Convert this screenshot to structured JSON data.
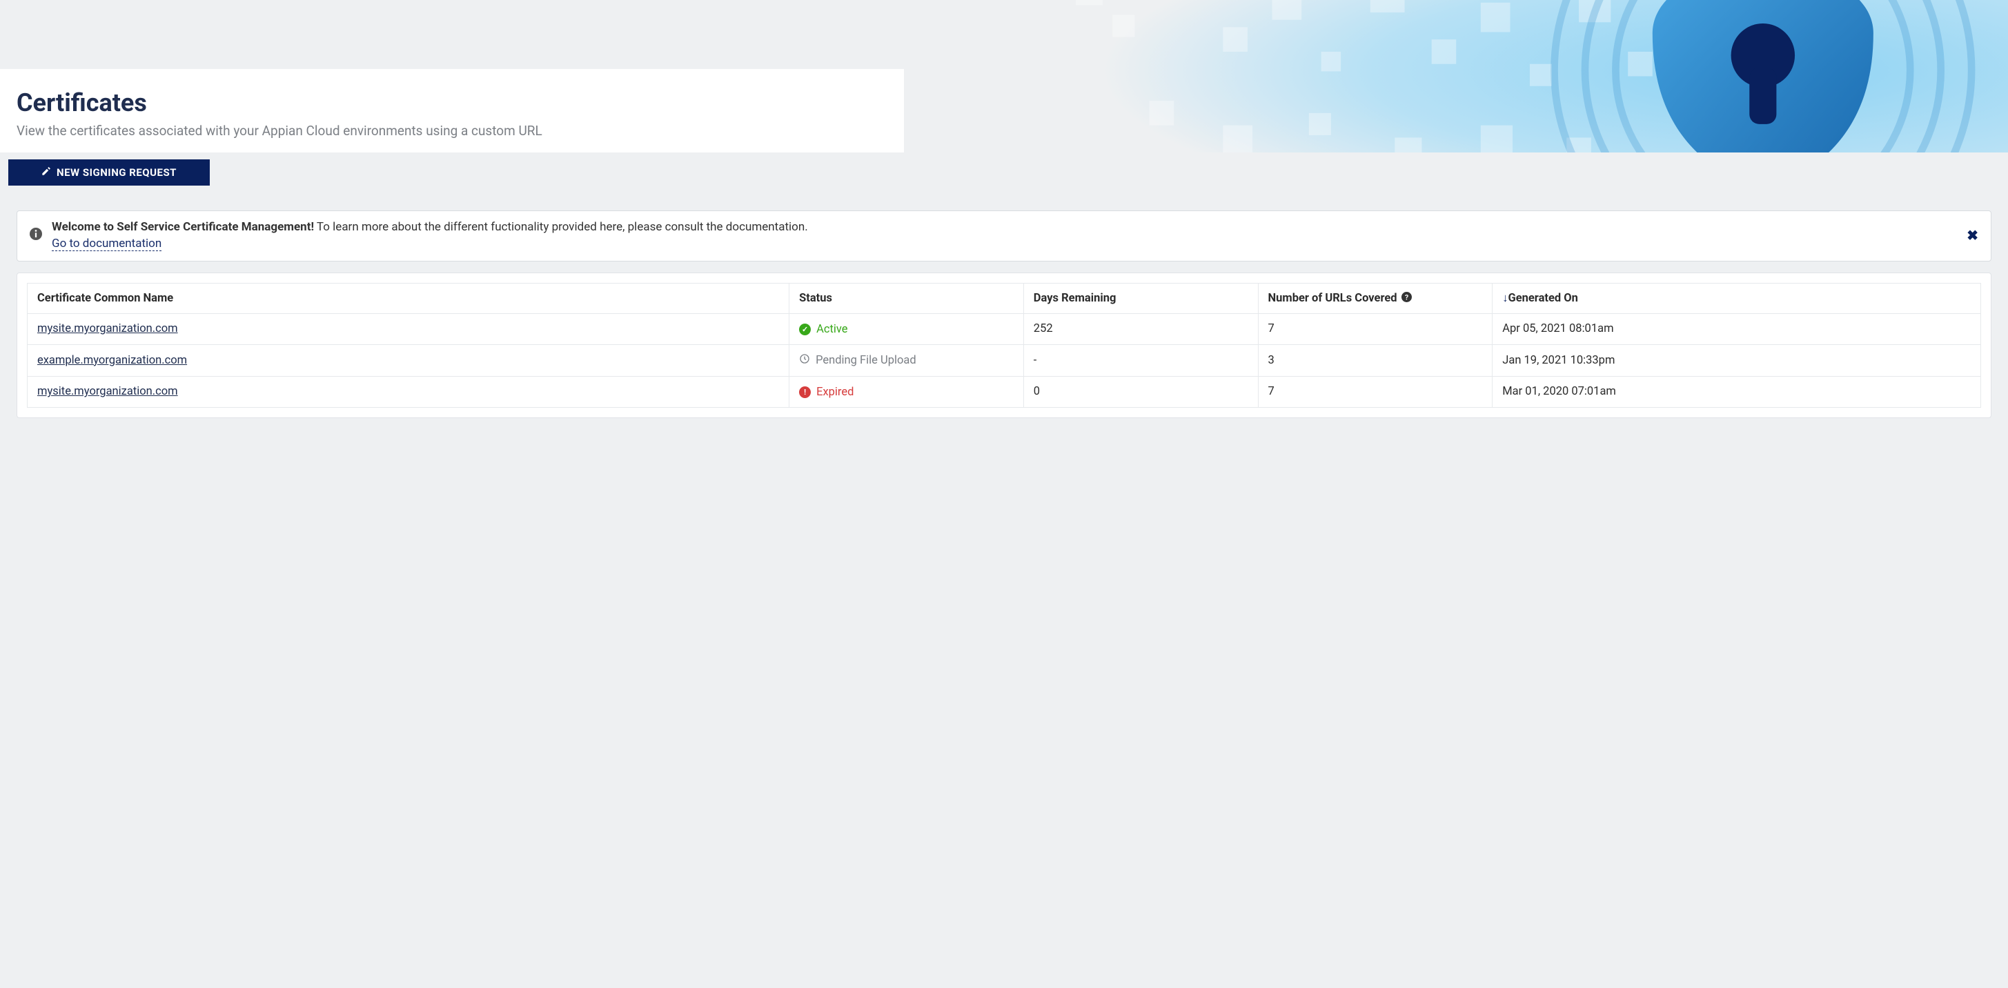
{
  "header": {
    "title": "Certificates",
    "subtitle": "View the certificates associated with your Appian Cloud environments using a custom URL"
  },
  "actions": {
    "new_request_label": "NEW SIGNING REQUEST"
  },
  "banner": {
    "bold": "Welcome to Self Service Certificate Management!",
    "text": " To learn more about the different fuctionality provided here, please consult the documentation.",
    "link_label": "Go to documentation"
  },
  "table": {
    "headers": {
      "name": "Certificate Common Name",
      "status": "Status",
      "days": "Days Remaining",
      "urls": "Number of URLs Covered",
      "generated": "Generated On"
    },
    "rows": [
      {
        "name": "mysite.myorganization.com",
        "status": "Active",
        "status_type": "active",
        "days": "252",
        "urls": "7",
        "generated": "Apr 05, 2021 08:01am"
      },
      {
        "name": "example.myorganization.com",
        "status": "Pending File Upload",
        "status_type": "pending",
        "days": "-",
        "urls": "3",
        "generated": "Jan 19, 2021 10:33pm"
      },
      {
        "name": "mysite.myorganization.com",
        "status": "Expired",
        "status_type": "expired",
        "days": "0",
        "urls": "7",
        "generated": "Mar 01, 2020 07:01am"
      }
    ]
  }
}
